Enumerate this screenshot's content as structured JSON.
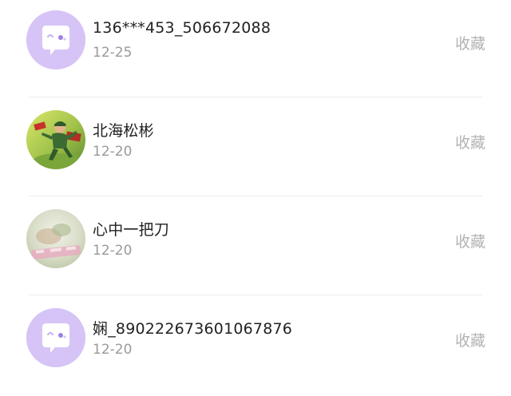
{
  "colors": {
    "default_avatar_bg": "#d6c4f6",
    "name_text": "#222222",
    "date_text": "#9a9a9a",
    "collect_text": "#b3b3b3",
    "divider": "#ececec"
  },
  "items": [
    {
      "name": "136***453_506672088",
      "date": "12-25",
      "action": "收藏",
      "avatar": "default-chat-bubble-icon"
    },
    {
      "name": "北海松彬",
      "date": "12-20",
      "action": "收藏",
      "avatar": "photo-soldier-avatar"
    },
    {
      "name": "心中一把刀",
      "date": "12-20",
      "action": "收藏",
      "avatar": "photo-blurred-avatar"
    },
    {
      "name": "娴_890222673601067876",
      "date": "12-20",
      "action": "收藏",
      "avatar": "default-chat-bubble-icon"
    }
  ]
}
